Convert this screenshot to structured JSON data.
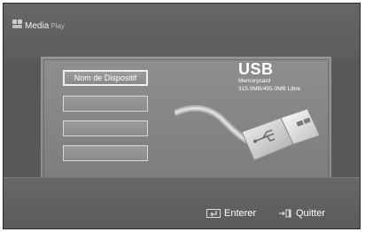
{
  "brand": {
    "name": "Media",
    "sub": "Play"
  },
  "devices": [
    {
      "label": "Nom de Dispositif",
      "selected": true
    },
    {
      "label": "",
      "selected": false
    },
    {
      "label": "",
      "selected": false
    },
    {
      "label": "",
      "selected": false
    }
  ],
  "usb": {
    "title": "USB",
    "type": "Memorycard",
    "capacity": "315.0MB/495.0MB Libre"
  },
  "footer": {
    "enter_label": "Enterer",
    "enter_icon": "enter-icon",
    "quit_label": "Quitter",
    "quit_icon": "exit-icon"
  }
}
